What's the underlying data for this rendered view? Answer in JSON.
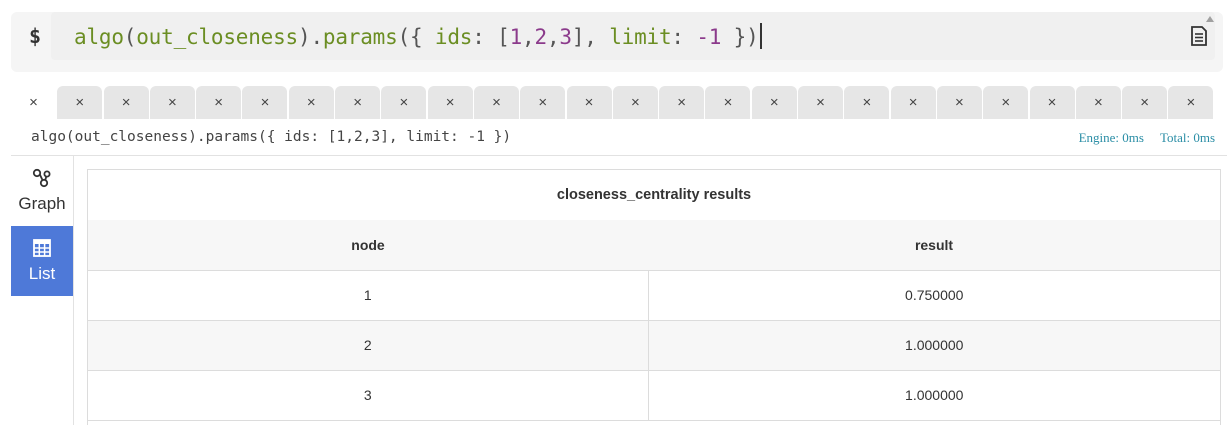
{
  "command": {
    "prompt": "$",
    "tokens": [
      {
        "text": "algo",
        "cls": "t-fn"
      },
      {
        "text": "(",
        "cls": "t-par"
      },
      {
        "text": "out_closeness",
        "cls": "t-id"
      },
      {
        "text": ").",
        "cls": "t-par"
      },
      {
        "text": "params",
        "cls": "t-fn"
      },
      {
        "text": "({ ",
        "cls": "t-punc"
      },
      {
        "text": "ids",
        "cls": "t-key"
      },
      {
        "text": ": [",
        "cls": "t-punc"
      },
      {
        "text": "1",
        "cls": "t-num"
      },
      {
        "text": ",",
        "cls": "t-punc"
      },
      {
        "text": "2",
        "cls": "t-num"
      },
      {
        "text": ",",
        "cls": "t-punc"
      },
      {
        "text": "3",
        "cls": "t-num"
      },
      {
        "text": "], ",
        "cls": "t-punc"
      },
      {
        "text": "limit",
        "cls": "t-key"
      },
      {
        "text": ": ",
        "cls": "t-punc"
      },
      {
        "text": "-1",
        "cls": "t-num"
      },
      {
        "text": " })",
        "cls": "t-punc"
      }
    ],
    "doc_icon": "document-icon"
  },
  "tabs": {
    "close_glyph": "×",
    "count": 26
  },
  "query": {
    "text": "algo(out_closeness).params({ ids: [1,2,3], limit: -1 })",
    "engine": "Engine: 0ms",
    "total": "Total: 0ms"
  },
  "side": {
    "items": [
      {
        "label": "Graph",
        "icon": "graph-icon",
        "active": false
      },
      {
        "label": "List",
        "icon": "table-icon",
        "active": true
      }
    ]
  },
  "results": {
    "title": "closeness_centrality results",
    "columns": [
      "node",
      "result"
    ],
    "rows": [
      [
        "1",
        "0.750000"
      ],
      [
        "2",
        "1.000000"
      ],
      [
        "3",
        "1.000000"
      ]
    ]
  },
  "colors": {
    "accent": "#4e79d8",
    "timing": "#2b8ea6",
    "code_fn": "#6b8e23",
    "code_num": "#8b3a8b"
  }
}
